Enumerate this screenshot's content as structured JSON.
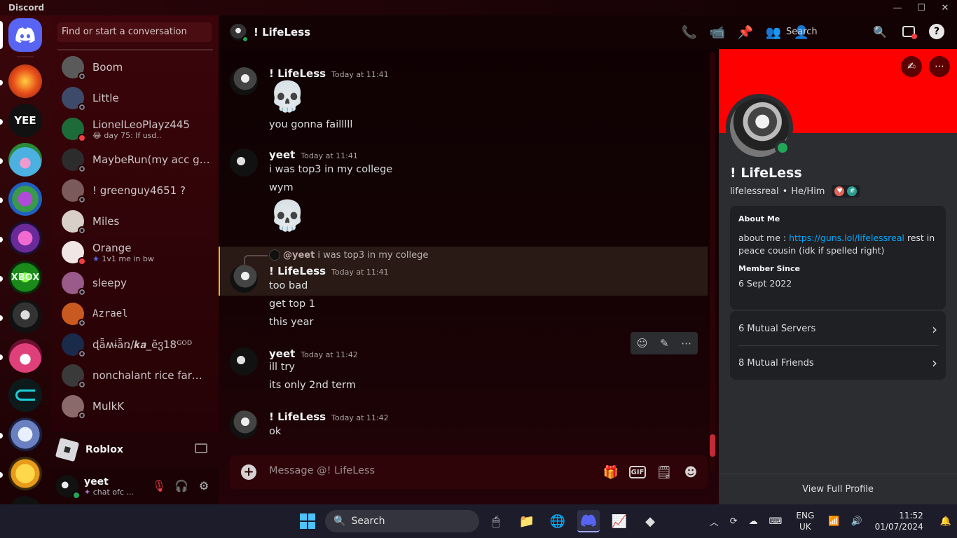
{
  "window": {
    "title": "Discord"
  },
  "dm_search": {
    "placeholder": "Find or start a conversation"
  },
  "dm_list": [
    {
      "name": "Boom",
      "sub": "",
      "status": "offline",
      "avatar_color": "#5a5a5a"
    },
    {
      "name": "Little",
      "sub": "",
      "status": "offline",
      "avatar_color": "#3e4a6a"
    },
    {
      "name": "LionelLeoPlayz445",
      "sub": "😂 day 75: lf usd..",
      "status": "dnd",
      "avatar_color": "#1e6b3a"
    },
    {
      "name": "MaybeRun(my acc got...",
      "sub": "",
      "status": "offline",
      "avatar_color": "#2c2c2c"
    },
    {
      "name": "! greenguy4651 ?",
      "sub": "",
      "status": "offline",
      "avatar_color": "#7a5a5a"
    },
    {
      "name": "Miles",
      "sub": "",
      "status": "offline",
      "avatar_color": "#d8d0c8"
    },
    {
      "name": "Orange",
      "sub": "1v1 me in bw",
      "status": "dnd",
      "avatar_color": "#f0e6e6"
    },
    {
      "name": "sleepy",
      "sub": "",
      "status": "offline",
      "avatar_color": "#9a5a8a"
    },
    {
      "name": "Azrael",
      "sub": "",
      "status": "offline",
      "avatar_color": "#c85a20"
    },
    {
      "name": "ɖǟʍɨǟռ/𝒌𝒂_ĕჳ18ᴳᴼᴰ",
      "sub": "",
      "status": "offline",
      "avatar_color": "#1a2a4a"
    },
    {
      "name": "nonchalant rice farmer",
      "sub": "",
      "status": "offline",
      "avatar_color": "#3a3a3a"
    },
    {
      "name": "MulkK",
      "sub": "",
      "status": "offline",
      "avatar_color": "#8a6a6a"
    }
  ],
  "activity": {
    "label": "Roblox"
  },
  "current_user": {
    "name": "yeet",
    "status_text": "chat ofc ..."
  },
  "chat_header": {
    "title": "! LifeLess",
    "search_label": "Search"
  },
  "messages": {
    "m1": {
      "author": "! LifeLess",
      "time": "Today at 11:41",
      "lines": [
        "💀",
        "you gonna failllll"
      ]
    },
    "m2": {
      "author": "yeet",
      "time": "Today at 11:41",
      "lines": [
        "i was top3 in my college",
        "wym",
        "💀"
      ]
    },
    "m3": {
      "reply_user": "@yeet",
      "reply_text": "i was top3 in my college",
      "author": "! LifeLess",
      "time": "Today at 11:41",
      "lines": [
        "too bad",
        "get top 1",
        "this year"
      ]
    },
    "m4": {
      "author": "yeet",
      "time": "Today at 11:42",
      "lines": [
        "ill try",
        "its only 2nd term"
      ]
    },
    "m5": {
      "author": "! LifeLess",
      "time": "Today at 11:42",
      "lines": [
        "ok"
      ]
    }
  },
  "composer": {
    "placeholder": "Message @! LifeLess",
    "gif_label": "GIF"
  },
  "profile": {
    "display_name": "! LifeLess",
    "username": "lifelessreal",
    "pronouns": "He/Him",
    "banner_color": "#ff0000",
    "about_heading": "About Me",
    "about_prefix": "about me : ",
    "about_link": "https://guns.lol/lifelessreal",
    "about_suffix": " rest in peace cousin (idk if spelled right)",
    "member_since_heading": "Member Since",
    "member_since": "6 Sept 2022",
    "mutual_servers": "6 Mutual Servers",
    "mutual_friends": "8 Mutual Friends",
    "view_full": "View Full Profile"
  },
  "taskbar": {
    "search_label": "Search",
    "lang_top": "ENG",
    "lang_bottom": "UK",
    "time": "11:52",
    "date": "01/07/2024"
  }
}
